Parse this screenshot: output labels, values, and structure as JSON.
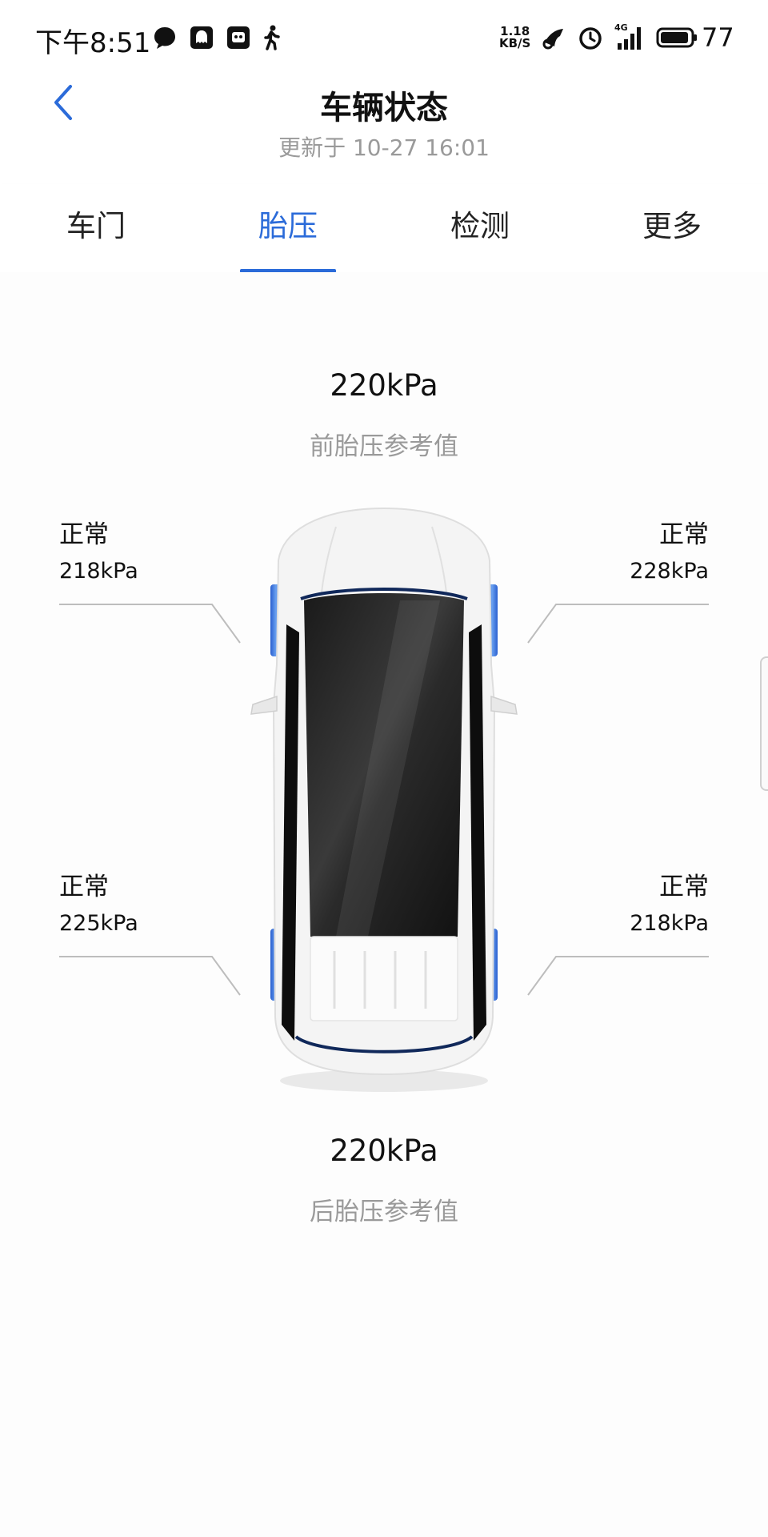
{
  "status_bar": {
    "time": "下午8:51",
    "net_speed_value": "1.18",
    "net_speed_unit": "KB/S",
    "network": "4G",
    "battery": "77",
    "icons": [
      "chat-bubble-icon",
      "ghost-app-icon",
      "robot-app-icon",
      "walking-icon",
      "nfc-icon",
      "alarm-icon",
      "signal-icon",
      "battery-icon"
    ]
  },
  "header": {
    "title": "车辆状态",
    "subtitle": "更新于 10-27 16:01"
  },
  "tabs": [
    {
      "label": "车门",
      "active": false
    },
    {
      "label": "胎压",
      "active": true
    },
    {
      "label": "检测",
      "active": false
    },
    {
      "label": "更多",
      "active": false
    }
  ],
  "tire_pressure": {
    "front_reference": {
      "value": "220kPa",
      "label": "前胎压参考值"
    },
    "rear_reference": {
      "value": "220kPa",
      "label": "后胎压参考值"
    },
    "front_left": {
      "status": "正常",
      "value": "218kPa"
    },
    "front_right": {
      "status": "正常",
      "value": "228kPa"
    },
    "rear_left": {
      "status": "正常",
      "value": "225kPa"
    },
    "rear_right": {
      "status": "正常",
      "value": "218kPa"
    }
  },
  "colors": {
    "accent": "#2b6bd9",
    "tire_highlight": "#3f7fe0",
    "muted_text": "#9a9a9a"
  }
}
